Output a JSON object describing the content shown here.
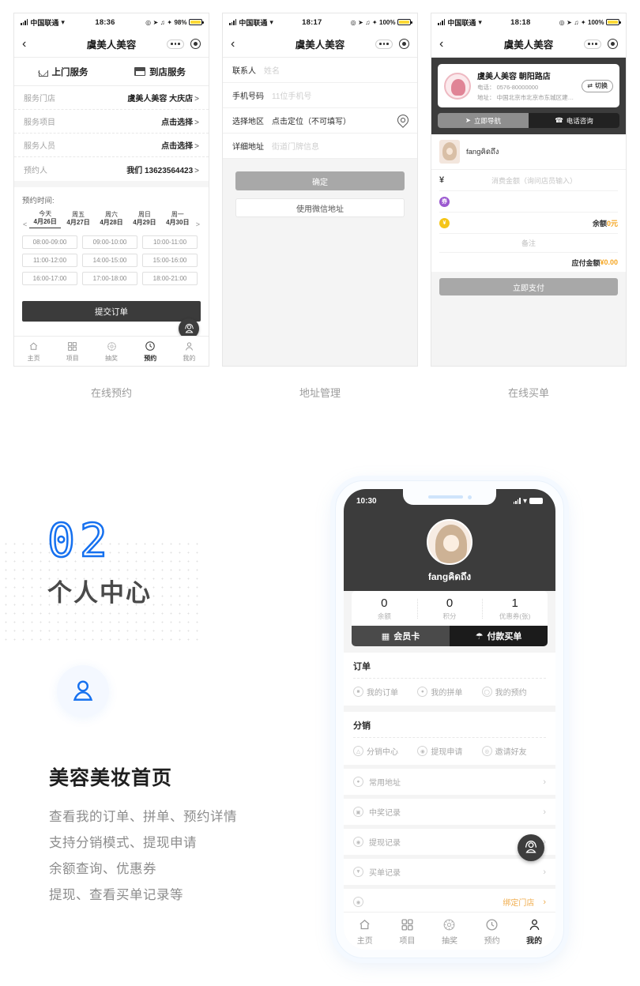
{
  "screens": [
    {
      "caption": "在线预约",
      "status": {
        "carrier": "中国联通",
        "time": "18:36",
        "battery": "98%"
      },
      "nav": {
        "title": "虞美人美容",
        "back": "‹"
      },
      "tabs": [
        {
          "label": "上门服务",
          "icon": "home-icon"
        },
        {
          "label": "到店服务",
          "icon": "shop-icon"
        }
      ],
      "form": [
        {
          "label": "服务门店",
          "value": "虞美人美容 大庆店",
          "arrow": true
        },
        {
          "label": "服务项目",
          "value": "点击选择",
          "arrow": true
        },
        {
          "label": "服务人员",
          "value": "点击选择",
          "arrow": true
        },
        {
          "label": "预约人",
          "value": "我们 13623564423",
          "arrow": true
        }
      ],
      "booking": {
        "title": "预约时间:",
        "prev": "<",
        "next": ">",
        "dates": [
          {
            "week": "今天",
            "day": "4月26日",
            "active": true
          },
          {
            "week": "周五",
            "day": "4月27日",
            "active": false
          },
          {
            "week": "周六",
            "day": "4月28日",
            "active": false
          },
          {
            "week": "周日",
            "day": "4月29日",
            "active": false
          },
          {
            "week": "周一",
            "day": "4月30日",
            "active": false
          }
        ],
        "slots": [
          "08:00-09:00",
          "09:00-10:00",
          "10:00-11:00",
          "11:00-12:00",
          "14:00-15:00",
          "15:00-16:00",
          "16:00-17:00",
          "17:00-18:00",
          "18:00-21:00"
        ]
      },
      "submit_label": "提交订单",
      "fab": "customer-service-icon",
      "bottom_nav": [
        {
          "label": "主页",
          "icon": "home-icon",
          "active": false
        },
        {
          "label": "项目",
          "icon": "grid-icon",
          "active": false
        },
        {
          "label": "抽奖",
          "icon": "lottery-icon",
          "active": false
        },
        {
          "label": "预约",
          "icon": "clock-icon",
          "active": true
        },
        {
          "label": "我的",
          "icon": "person-icon",
          "active": false
        }
      ]
    },
    {
      "caption": "地址管理",
      "status": {
        "carrier": "中国联通",
        "time": "18:17",
        "battery": "100%"
      },
      "nav": {
        "title": "虞美人美容",
        "back": "‹"
      },
      "fields": [
        {
          "label": "联系人",
          "placeholder": "姓名",
          "value": ""
        },
        {
          "label": "手机号码",
          "placeholder": "11位手机号",
          "value": ""
        },
        {
          "label": "选择地区",
          "placeholder": "",
          "value": "点击定位（不可填写）",
          "icon": "location-pin-icon"
        },
        {
          "label": "详细地址",
          "placeholder": "街道门牌信息",
          "value": ""
        }
      ],
      "confirm_label": "确定",
      "wechat_label": "使用微信地址"
    },
    {
      "caption": "在线买单",
      "status": {
        "carrier": "中国联通",
        "time": "18:18",
        "battery": "100%"
      },
      "nav": {
        "title": "虞美人美容",
        "back": "‹"
      },
      "store": {
        "name": "虞美人美容 朝阳路店",
        "phone": "电话： 0576-80000000",
        "address": "地址： 中国北京市北京市东城区建国门...",
        "switch_label": "切换",
        "nav_label": "立即导航",
        "call_label": "电话咨询"
      },
      "user": "fangคิดถึง",
      "pay": {
        "amount_placeholder": "消费金额（询问店员输入）",
        "coupon_icon": "券",
        "balance_icon": "¥",
        "balance_label": "余额",
        "balance_value": "0元",
        "remark_placeholder": "备注",
        "total_label": "应付金额",
        "total_value": "¥0.00",
        "pay_button": "立即支付"
      }
    }
  ],
  "section": {
    "number": "02",
    "title": "个人中心",
    "icon": "person-icon",
    "heading": "美容美妆首页",
    "description": [
      "查看我的订单、拼单、预约详情",
      "支持分销模式、提现申请",
      "余额查询、优惠券",
      "提现、查看买单记录等"
    ]
  },
  "bigphone": {
    "status": {
      "time": "10:30"
    },
    "profile": {
      "username": "fangคิดถึง",
      "stats": [
        {
          "value": "0",
          "label": "余额"
        },
        {
          "value": "0",
          "label": "积分"
        },
        {
          "value": "1",
          "label": "优惠券(张)"
        }
      ],
      "buttons": [
        {
          "label": "会员卡",
          "icon": "card-icon"
        },
        {
          "label": "付款买单",
          "icon": "pay-icon"
        }
      ]
    },
    "sections": [
      {
        "title": "订单",
        "items": [
          {
            "label": "我的订单",
            "icon": "order-icon"
          },
          {
            "label": "我的拼单",
            "icon": "group-buy-icon"
          },
          {
            "label": "我的预约",
            "icon": "clock-icon"
          }
        ]
      },
      {
        "title": "分销",
        "items": [
          {
            "label": "分销中心",
            "icon": "distribution-icon"
          },
          {
            "label": "提现申请",
            "icon": "withdraw-icon"
          },
          {
            "label": "邀请好友",
            "icon": "invite-icon"
          }
        ]
      }
    ],
    "list": [
      {
        "label": "常用地址",
        "icon": "location-pin-icon",
        "highlight": false
      },
      {
        "label": "中奖记录",
        "icon": "prize-icon",
        "highlight": false
      },
      {
        "label": "提现记录",
        "icon": "withdraw-icon",
        "highlight": false
      },
      {
        "label": "买单记录",
        "icon": "receipt-icon",
        "highlight": false
      },
      {
        "label": "绑定门店",
        "icon": "store-icon",
        "highlight": true
      }
    ],
    "fab": "customer-service-icon",
    "bottom_nav": [
      {
        "label": "主页",
        "icon": "home-icon",
        "active": false
      },
      {
        "label": "项目",
        "icon": "grid-icon",
        "active": false
      },
      {
        "label": "抽奖",
        "icon": "lottery-icon",
        "active": false
      },
      {
        "label": "预约",
        "icon": "clock-icon",
        "active": false
      },
      {
        "label": "我的",
        "icon": "person-icon",
        "active": true
      }
    ]
  },
  "colors": {
    "accent_blue": "#1570ef",
    "dark": "#3c3c3c",
    "orange": "#f0ad4e",
    "gray_button": "#a8a8a8"
  }
}
